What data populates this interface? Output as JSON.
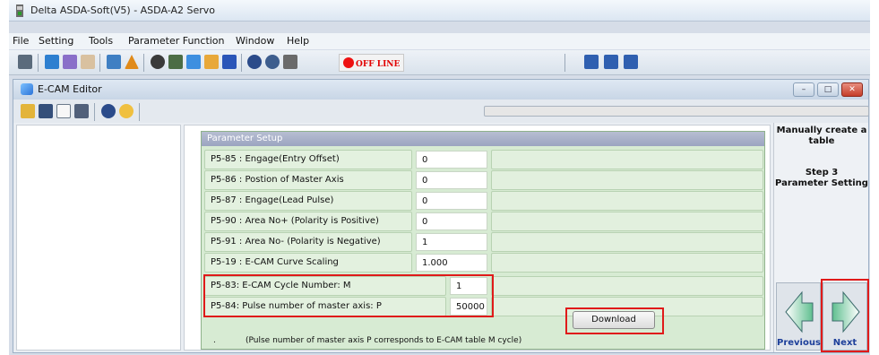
{
  "window": {
    "title": "Delta ASDA-Soft(V5) - ASDA-A2 Servo"
  },
  "menu": [
    "File",
    "Setting",
    "Tools",
    "Parameter Function",
    "Window",
    "Help"
  ],
  "toolbar": {
    "status_label": "OFF LINE"
  },
  "child": {
    "title": "E-CAM Editor",
    "min_label": "–",
    "max_label": "□",
    "close_label": "✕"
  },
  "params": {
    "header": "Parameter Setup",
    "rows": [
      {
        "label": "P5-85 : Engage(Entry Offset)",
        "value": "0"
      },
      {
        "label": "P5-86 : Postion of Master Axis",
        "value": "0"
      },
      {
        "label": "P5-87 : Engage(Lead Pulse)",
        "value": "0"
      },
      {
        "label": "P5-90 : Area No+ (Polarity is Positive)",
        "value": "0"
      },
      {
        "label": "P5-91 : Area No- (Polarity is Negative)",
        "value": "1"
      },
      {
        "label": "P5-19 : E-CAM Curve Scaling",
        "value": "1.000"
      },
      {
        "label": "P5-83: E-CAM Cycle Number: M",
        "value": "1"
      },
      {
        "label": "P5-84:  Pulse number of master axis: P",
        "value": "50000"
      }
    ],
    "note_dot": ".",
    "note": "(Pulse number of master axis P corresponds to E-CAM table M cycle)",
    "download_label": "Download"
  },
  "wizard": {
    "line1": "Manually create a table",
    "step": "Step 3",
    "step_title": "Parameter Setting",
    "previous_label": "Previous",
    "next_label": "Next"
  },
  "colors": {
    "highlight": "#e01a1a",
    "panel_green": "#d7ebd3",
    "nav_text": "#1d3f9a"
  }
}
